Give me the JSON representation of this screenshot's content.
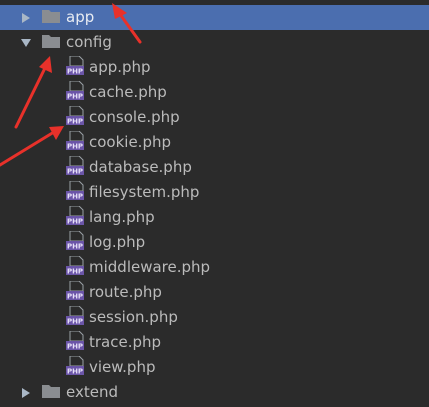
{
  "colors": {
    "background": "#2b2b2b",
    "text": "#bbbbbb",
    "selected_row": "#4b6eaf",
    "folder_icon": "#8a8d91",
    "php_badge": "#6b55a8",
    "annotation_arrow": "#e8312a"
  },
  "tree": {
    "app": {
      "label": "app",
      "state": "collapsed",
      "icon": "folder-icon"
    },
    "config": {
      "label": "config",
      "state": "expanded",
      "icon": "folder-icon",
      "files": [
        "app.php",
        "cache.php",
        "console.php",
        "cookie.php",
        "database.php",
        "filesystem.php",
        "lang.php",
        "log.php",
        "middleware.php",
        "route.php",
        "session.php",
        "trace.php",
        "view.php"
      ]
    },
    "extend": {
      "label": "extend",
      "state": "collapsed",
      "icon": "folder-icon"
    }
  }
}
